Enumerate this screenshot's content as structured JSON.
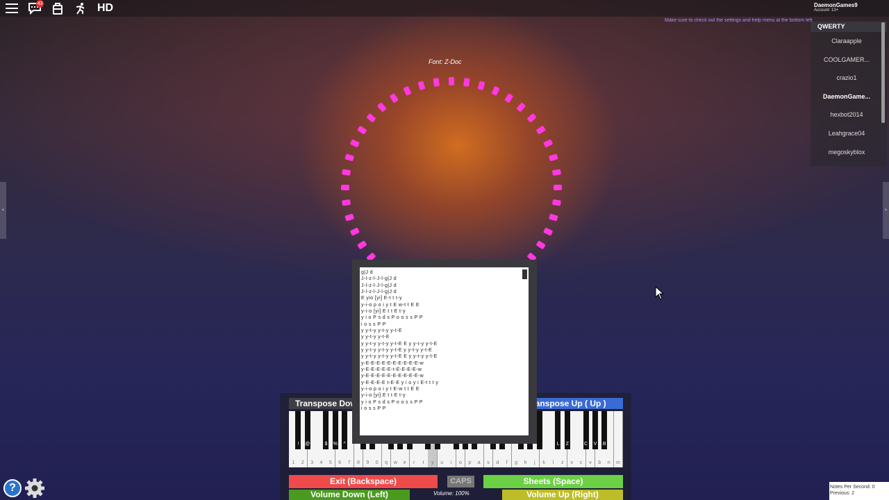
{
  "topbar": {
    "chat_badge": "43",
    "hd_label": "HD",
    "username": "DaemonGames9",
    "account_text": "Account: 13+"
  },
  "help_message": "Make sure to check out the settings and help menu at the bottom left",
  "player_list": {
    "header": "QWERTY",
    "players": [
      "Claraapple",
      "COOLGAMER...",
      "crazio1",
      "DaemonGame...",
      "hexbot2014",
      "Leahgrace04",
      "megoskyblox"
    ],
    "me_index": 3
  },
  "font_label": "Font: Z-Doc",
  "ring_color": "#ff38e0",
  "sheet": {
    "lines": [
      "g|J d",
      "J-l-z-l-J-l-g|J d",
      "J-l-z-l-J-l-g|J d",
      "J-l-z-l-J-l-g|J d",
      "E yio [yi] E-t t t-y",
      "y-i-o p o i y t E w-t t E E",
      "y-i-o [yi] E t t E t-y",
      "y i o P s d s P o o s s P P",
      "i o s s P P",
      "y y-t-y y-t-y y-t-E",
      "y y-t-y y-t-E",
      "y y-t-y y-t-y y-t-E E y y-t-y y-t-E",
      "y y-t-y y-t-y y-t-E y y-t-y y-t-E",
      "y y-t-y y-t-y y-t-E E y y-t-y y-t-E",
      "y-E-E-E-E-E-E-E-E-E-E-w",
      "y-E-E-E-E-E-t-E-E-E-E-w",
      "y-E-E-E-E-E-E-E-E-E-E-w",
      "y-E-E-E-E t-E-E y i o y i E-t t t y",
      "y-i-o p o i y t E-w t t E E",
      "y-i-o [yi] E t t E t-y",
      "y i o P s d s P o o s s P P",
      "i o s s P P"
    ]
  },
  "piano": {
    "transpose_down": "Transpose Down ( Down )",
    "transpose_up": "Transpose Up ( Up )",
    "white_keys": [
      "1",
      "2",
      "3",
      "4",
      "5",
      "6",
      "7",
      "8",
      "9",
      "0",
      "q",
      "w",
      "e",
      "r",
      "t",
      "y",
      "u",
      "i",
      "o",
      "p",
      "a",
      "s",
      "d",
      "f",
      "g",
      "h",
      "j",
      "k",
      "l",
      "z",
      "x",
      "c",
      "v",
      "b",
      "n",
      "m"
    ],
    "pressed_key": "y",
    "black_keys_left": [
      "!",
      "@",
      "$",
      "%",
      "^"
    ],
    "black_keys_right": [
      "L",
      "Z",
      "C",
      "V",
      "B"
    ],
    "exit_label": "Exit (Backspace)",
    "caps_label": "CAPS",
    "sheets_label": "Sheets (Space)",
    "volume_down_label": "Volume Down (Left)",
    "volume_label": "Volume: 100%",
    "volume_up_label": "Volume Up (Right)"
  },
  "stats": {
    "nps": "Notes Per Second: 0",
    "previous": "Previous: 2"
  },
  "colors": {
    "exit": "#ef4b4b",
    "sheets": "#6bd044",
    "volume_down": "#4a9a20",
    "volume_up": "#bdbd2a",
    "transpose_up": "#3a6bd4"
  }
}
